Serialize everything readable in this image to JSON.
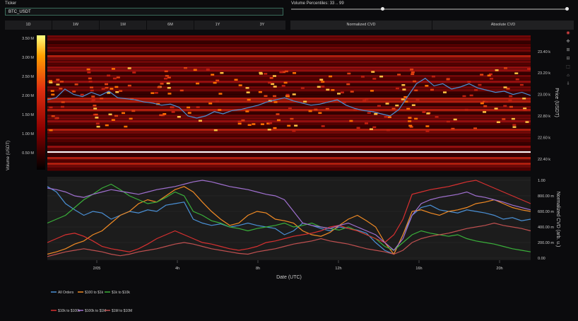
{
  "ticker": {
    "label": "Ticker",
    "value": "BTC_USDT"
  },
  "volume_percentiles": {
    "label": "Volume Percentiles: 33 .. 99",
    "low": 33,
    "high": 99
  },
  "timeframes": [
    "1D",
    "1W",
    "1M",
    "6M",
    "1Y",
    "3Y"
  ],
  "cvd_tabs": [
    "Normalized CVD",
    "Absolute CVD"
  ],
  "legend": [
    {
      "name": "All Orders",
      "color": "#4a8fd4"
    },
    {
      "name": "$100 to $1k",
      "color": "#f08a24"
    },
    {
      "name": "$1k to $10k",
      "color": "#3ab03a"
    },
    {
      "name": "$10k to $100k",
      "color": "#d83030"
    },
    {
      "name": "$100k to $1M",
      "color": "#a070d0"
    },
    {
      "name": "$1M to $10M",
      "color": "#c05050"
    }
  ],
  "colorbar": {
    "label": "Volume (USDT)",
    "ticks": [
      "3.50 M",
      "3.00 M",
      "2.50 M",
      "2.00 M",
      "1.50 M",
      "1.00 M",
      "0.50 M"
    ]
  },
  "chart_data": [
    {
      "type": "heatmap",
      "ylabel": "Price (USDT)",
      "yticks": [
        "23.40 k",
        "23.20 k",
        "23.00 k",
        "22.80 k",
        "22.60 k",
        "22.40 k"
      ],
      "price_line": [
        22.95,
        22.97,
        23.05,
        23.0,
        22.98,
        23.02,
        22.99,
        23.03,
        22.97,
        22.96,
        22.95,
        22.93,
        22.92,
        22.9,
        22.91,
        22.88,
        22.8,
        22.78,
        22.8,
        22.84,
        22.82,
        22.85,
        22.86,
        22.88,
        22.9,
        22.93,
        22.95,
        22.97,
        22.94,
        22.92,
        22.9,
        22.91,
        22.93,
        22.95,
        22.9,
        22.87,
        22.85,
        22.84,
        22.82,
        22.8,
        22.86,
        22.98,
        23.1,
        23.15,
        23.08,
        23.1,
        23.05,
        23.07,
        23.1,
        23.06,
        23.04,
        23.02,
        23.03,
        23.0,
        23.02,
        22.99
      ],
      "yrange": [
        22.3,
        23.55
      ]
    },
    {
      "type": "line",
      "xlabel": "Date (UTC)",
      "ylabel": "Normalized CVD (arb. u.)",
      "xticks": [
        "2/05",
        "4h",
        "8h",
        "12h",
        "16h",
        "20h"
      ],
      "yticks": [
        "1.00",
        "800.00 m",
        "600.00 m",
        "400.00 m",
        "200.00 m",
        "0.00"
      ],
      "ylim": [
        0,
        1
      ],
      "series": [
        {
          "name": "All Orders",
          "color": "#4a8fd4",
          "values": [
            0.92,
            0.85,
            0.7,
            0.62,
            0.55,
            0.6,
            0.58,
            0.5,
            0.55,
            0.6,
            0.58,
            0.62,
            0.6,
            0.68,
            0.7,
            0.72,
            0.5,
            0.45,
            0.42,
            0.44,
            0.4,
            0.42,
            0.45,
            0.42,
            0.4,
            0.38,
            0.3,
            0.35,
            0.45,
            0.42,
            0.38,
            0.35,
            0.4,
            0.38,
            0.36,
            0.32,
            0.2,
            0.1,
            0.05,
            0.3,
            0.55,
            0.65,
            0.68,
            0.62,
            0.6,
            0.58,
            0.62,
            0.6,
            0.58,
            0.55,
            0.5,
            0.52,
            0.48,
            0.5
          ]
        },
        {
          "name": "$100 to $1k",
          "color": "#f08a24",
          "values": [
            0.05,
            0.08,
            0.12,
            0.18,
            0.22,
            0.3,
            0.35,
            0.45,
            0.55,
            0.6,
            0.7,
            0.75,
            0.72,
            0.8,
            0.88,
            0.92,
            0.85,
            0.72,
            0.6,
            0.5,
            0.42,
            0.45,
            0.55,
            0.6,
            0.58,
            0.5,
            0.48,
            0.45,
            0.35,
            0.3,
            0.28,
            0.33,
            0.42,
            0.5,
            0.55,
            0.48,
            0.4,
            0.2,
            0.05,
            0.3,
            0.6,
            0.62,
            0.58,
            0.55,
            0.6,
            0.62,
            0.65,
            0.7,
            0.72,
            0.75,
            0.7,
            0.65,
            0.62,
            0.6
          ]
        },
        {
          "name": "$1k to $10k",
          "color": "#3ab03a",
          "values": [
            0.45,
            0.5,
            0.55,
            0.65,
            0.75,
            0.82,
            0.9,
            0.95,
            0.88,
            0.8,
            0.75,
            0.7,
            0.72,
            0.78,
            0.85,
            0.8,
            0.6,
            0.55,
            0.48,
            0.45,
            0.4,
            0.38,
            0.35,
            0.38,
            0.4,
            0.42,
            0.45,
            0.4,
            0.42,
            0.45,
            0.4,
            0.38,
            0.36,
            0.4,
            0.35,
            0.3,
            0.25,
            0.15,
            0.1,
            0.2,
            0.3,
            0.35,
            0.32,
            0.3,
            0.28,
            0.3,
            0.25,
            0.22,
            0.2,
            0.18,
            0.15,
            0.12,
            0.1,
            0.08
          ]
        },
        {
          "name": "$10k to $100k",
          "color": "#d83030",
          "values": [
            0.2,
            0.25,
            0.3,
            0.32,
            0.28,
            0.22,
            0.15,
            0.12,
            0.1,
            0.08,
            0.12,
            0.18,
            0.25,
            0.3,
            0.35,
            0.3,
            0.25,
            0.2,
            0.18,
            0.15,
            0.12,
            0.1,
            0.12,
            0.15,
            0.2,
            0.22,
            0.25,
            0.28,
            0.3,
            0.32,
            0.35,
            0.4,
            0.42,
            0.38,
            0.35,
            0.3,
            0.25,
            0.2,
            0.3,
            0.5,
            0.82,
            0.85,
            0.88,
            0.9,
            0.92,
            0.95,
            0.98,
            1.0,
            0.95,
            0.9,
            0.85,
            0.8,
            0.75,
            0.7
          ]
        },
        {
          "name": "$100k to $1M",
          "color": "#a070d0",
          "values": [
            0.9,
            0.88,
            0.85,
            0.8,
            0.78,
            0.82,
            0.85,
            0.88,
            0.86,
            0.84,
            0.82,
            0.85,
            0.88,
            0.9,
            0.92,
            0.95,
            0.98,
            1.0,
            0.98,
            0.95,
            0.92,
            0.9,
            0.88,
            0.85,
            0.82,
            0.8,
            0.75,
            0.6,
            0.45,
            0.42,
            0.4,
            0.38,
            0.42,
            0.45,
            0.4,
            0.35,
            0.3,
            0.2,
            0.1,
            0.25,
            0.55,
            0.7,
            0.75,
            0.78,
            0.8,
            0.82,
            0.85,
            0.8,
            0.78,
            0.75,
            0.72,
            0.68,
            0.65,
            0.62
          ]
        },
        {
          "name": "$1M to $10M",
          "color": "#c05050",
          "values": [
            0.02,
            0.05,
            0.08,
            0.1,
            0.12,
            0.1,
            0.08,
            0.05,
            0.03,
            0.05,
            0.08,
            0.1,
            0.12,
            0.15,
            0.18,
            0.2,
            0.18,
            0.15,
            0.12,
            0.1,
            0.08,
            0.06,
            0.05,
            0.08,
            0.1,
            0.12,
            0.15,
            0.18,
            0.2,
            0.22,
            0.25,
            0.22,
            0.2,
            0.18,
            0.15,
            0.12,
            0.1,
            0.08,
            0.05,
            0.1,
            0.2,
            0.25,
            0.28,
            0.3,
            0.32,
            0.35,
            0.38,
            0.4,
            0.42,
            0.45,
            0.42,
            0.4,
            0.38,
            0.35
          ]
        }
      ]
    }
  ]
}
